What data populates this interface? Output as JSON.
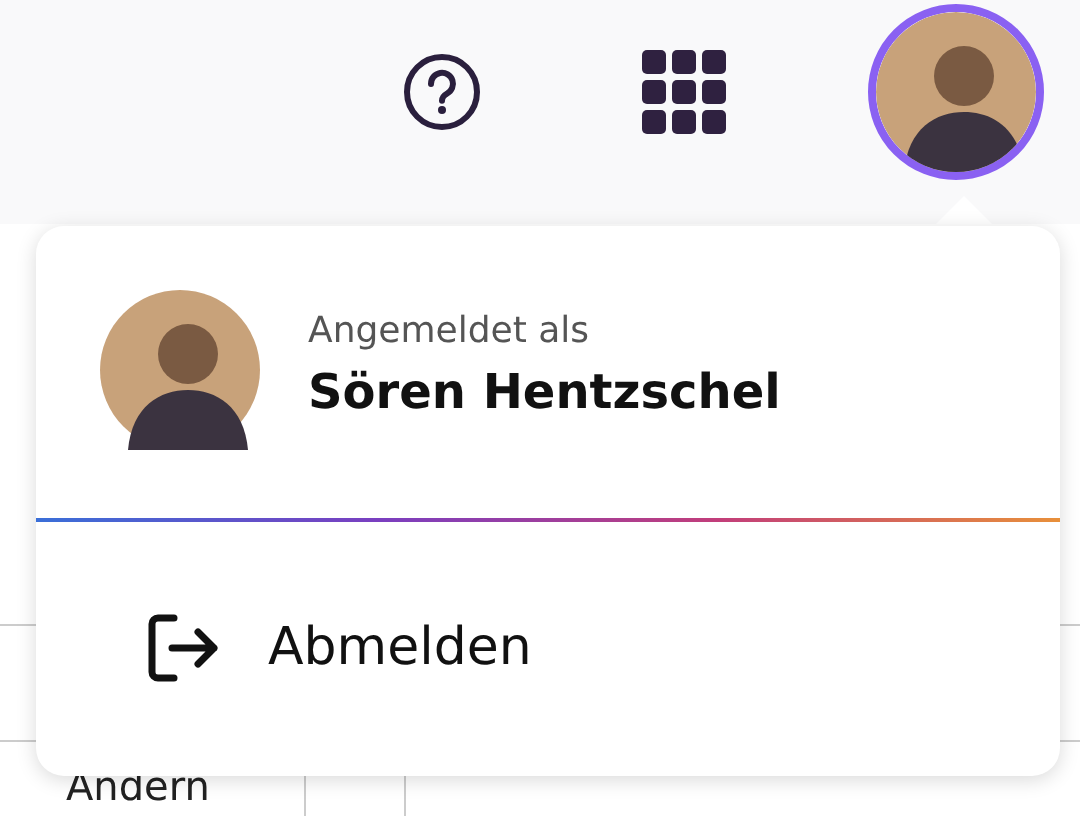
{
  "user_menu": {
    "open": true,
    "label": "Angemeldet als",
    "name": "Sören Hentzschel",
    "actions": [
      {
        "kind": "logout",
        "label": "Abmelden"
      }
    ]
  },
  "table": {
    "cells": [
      "Andern"
    ]
  }
}
